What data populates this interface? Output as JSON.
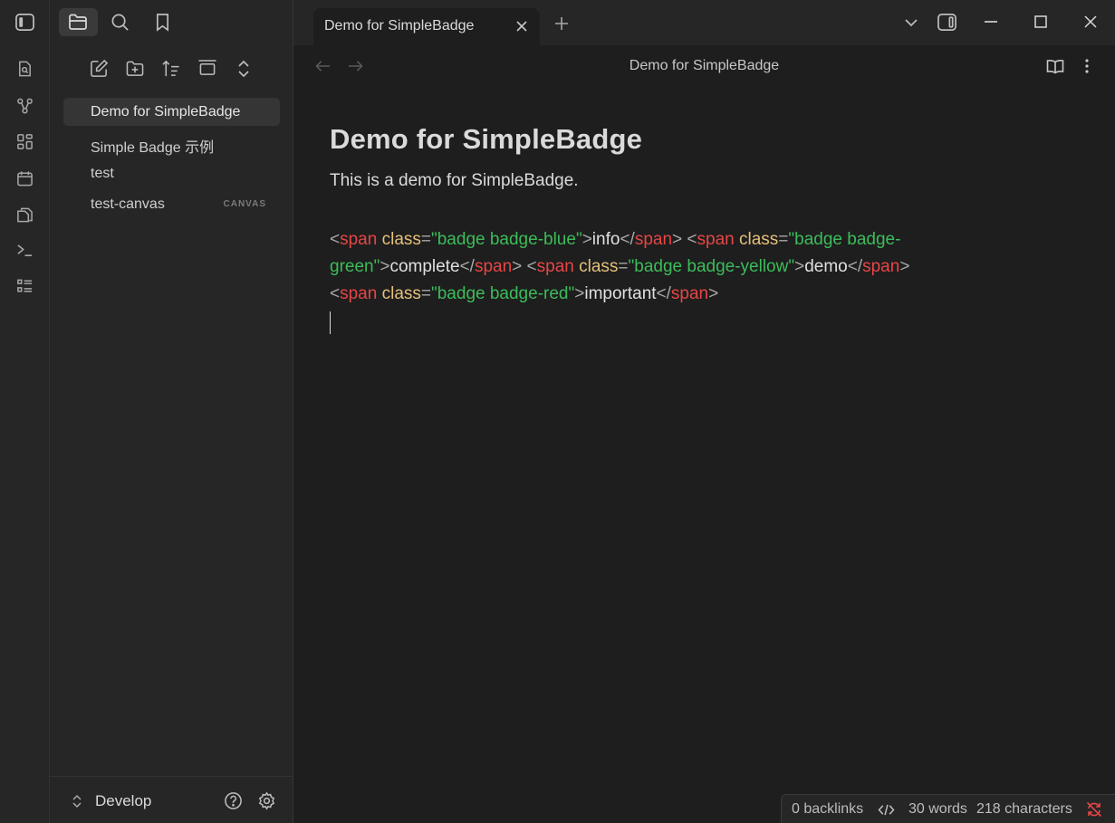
{
  "tab": {
    "title": "Demo for SimpleBadge"
  },
  "view": {
    "title": "Demo for SimpleBadge"
  },
  "files": [
    {
      "label": "Demo for SimpleBadge",
      "badge": ""
    },
    {
      "label": "Simple Badge 示例",
      "badge": ""
    },
    {
      "label": "test",
      "badge": ""
    },
    {
      "label": "test-canvas",
      "badge": "CANVAS"
    }
  ],
  "vault": {
    "name": "Develop"
  },
  "document": {
    "heading": "Demo for SimpleBadge",
    "paragraph": "This is a demo for SimpleBadge.",
    "code": {
      "tag": "span",
      "attr": "class",
      "line1": {
        "cls1": "\"badge badge-blue\"",
        "text1": "info",
        "cls2_part": "\"badge badge-"
      },
      "line2": {
        "cls2_rest": "green\"",
        "text2": "complete",
        "cls3": "\"badge badge-yellow\"",
        "text3": "demo"
      },
      "line3": {
        "cls4": "\"badge badge-red\"",
        "text4": "important"
      }
    }
  },
  "status": {
    "backlinks": "0 backlinks",
    "words": "30 words",
    "characters": "218 characters"
  },
  "colors": {
    "tag": "#e84545",
    "attr": "#e5c07b",
    "string": "#3cbc5a",
    "sync_error": "#e84545"
  }
}
